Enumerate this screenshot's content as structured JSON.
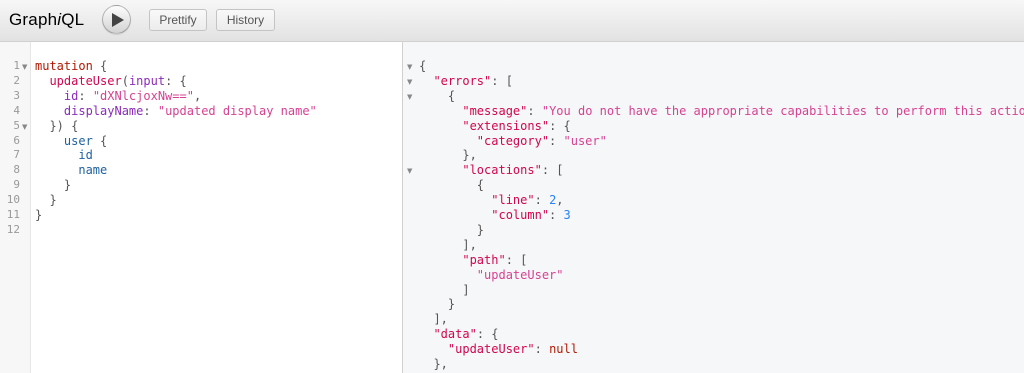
{
  "toolbar": {
    "logo_prefix": "Graph",
    "logo_i": "i",
    "logo_suffix": "QL",
    "prettify_label": "Prettify",
    "history_label": "History"
  },
  "query_editor": {
    "line_numbers": [
      "1",
      "2",
      "3",
      "4",
      "5",
      "6",
      "7",
      "8",
      "9",
      "10",
      "11",
      "12"
    ],
    "lines": [
      [
        [
          "kw",
          "mutation"
        ],
        [
          "pun",
          " {"
        ]
      ],
      [
        [
          "pun",
          "  "
        ],
        [
          "def",
          "updateUser"
        ],
        [
          "pun",
          "("
        ],
        [
          "att",
          "input"
        ],
        [
          "pun",
          ": {"
        ]
      ],
      [
        [
          "pun",
          "    "
        ],
        [
          "att",
          "id"
        ],
        [
          "pun",
          ": "
        ],
        [
          "str",
          "\"dXNlcjoxNw==\""
        ],
        [
          "pun",
          ","
        ]
      ],
      [
        [
          "pun",
          "    "
        ],
        [
          "att",
          "displayName"
        ],
        [
          "pun",
          ": "
        ],
        [
          "str",
          "\"updated display name\""
        ]
      ],
      [
        [
          "pun",
          "  }) {"
        ]
      ],
      [
        [
          "pun",
          "    "
        ],
        [
          "prop",
          "user"
        ],
        [
          "pun",
          " {"
        ]
      ],
      [
        [
          "pun",
          "      "
        ],
        [
          "prop",
          "id"
        ]
      ],
      [
        [
          "pun",
          "      "
        ],
        [
          "prop",
          "name"
        ]
      ],
      [
        [
          "pun",
          "    }"
        ]
      ],
      [
        [
          "pun",
          "  }"
        ]
      ],
      [
        [
          "pun",
          "}"
        ]
      ],
      []
    ]
  },
  "result_viewer": {
    "lines": [
      [
        [
          "pun",
          "{"
        ]
      ],
      [
        [
          "pun",
          "  "
        ],
        [
          "key",
          "\"errors\""
        ],
        [
          "pun",
          ": ["
        ]
      ],
      [
        [
          "pun",
          "    {"
        ]
      ],
      [
        [
          "pun",
          "      "
        ],
        [
          "key",
          "\"message\""
        ],
        [
          "pun",
          ": "
        ],
        [
          "str",
          "\"You do not have the appropriate capabilities to perform this action\""
        ],
        [
          "pun",
          ","
        ]
      ],
      [
        [
          "pun",
          "      "
        ],
        [
          "key",
          "\"extensions\""
        ],
        [
          "pun",
          ": {"
        ]
      ],
      [
        [
          "pun",
          "        "
        ],
        [
          "key",
          "\"category\""
        ],
        [
          "pun",
          ": "
        ],
        [
          "str",
          "\"user\""
        ]
      ],
      [
        [
          "pun",
          "      },"
        ]
      ],
      [
        [
          "pun",
          "      "
        ],
        [
          "key",
          "\"locations\""
        ],
        [
          "pun",
          ": ["
        ]
      ],
      [
        [
          "pun",
          "        {"
        ]
      ],
      [
        [
          "pun",
          "          "
        ],
        [
          "key",
          "\"line\""
        ],
        [
          "pun",
          ": "
        ],
        [
          "num",
          "2"
        ],
        [
          "pun",
          ","
        ]
      ],
      [
        [
          "pun",
          "          "
        ],
        [
          "key",
          "\"column\""
        ],
        [
          "pun",
          ": "
        ],
        [
          "num",
          "3"
        ]
      ],
      [
        [
          "pun",
          "        }"
        ]
      ],
      [
        [
          "pun",
          "      ],"
        ]
      ],
      [
        [
          "pun",
          "      "
        ],
        [
          "key",
          "\"path\""
        ],
        [
          "pun",
          ": ["
        ]
      ],
      [
        [
          "pun",
          "        "
        ],
        [
          "str",
          "\"updateUser\""
        ]
      ],
      [
        [
          "pun",
          "      ]"
        ]
      ],
      [
        [
          "pun",
          "    }"
        ]
      ],
      [
        [
          "pun",
          "  ],"
        ]
      ],
      [
        [
          "pun",
          "  "
        ],
        [
          "key",
          "\"data\""
        ],
        [
          "pun",
          ": {"
        ]
      ],
      [
        [
          "pun",
          "    "
        ],
        [
          "key",
          "\"updateUser\""
        ],
        [
          "pun",
          ": "
        ],
        [
          "kw",
          "null"
        ]
      ],
      [
        [
          "pun",
          "  },"
        ]
      ]
    ]
  },
  "icons": {
    "run": "play-icon",
    "fold": "fold-arrow-icon"
  },
  "colors": {
    "keyword": "#b11a04",
    "definition": "#d2054e",
    "property": "#1f61a0",
    "attribute": "#8b2bb9",
    "string": "#d64292",
    "number": "#2882f9",
    "result_background": "#f6f7f8"
  }
}
